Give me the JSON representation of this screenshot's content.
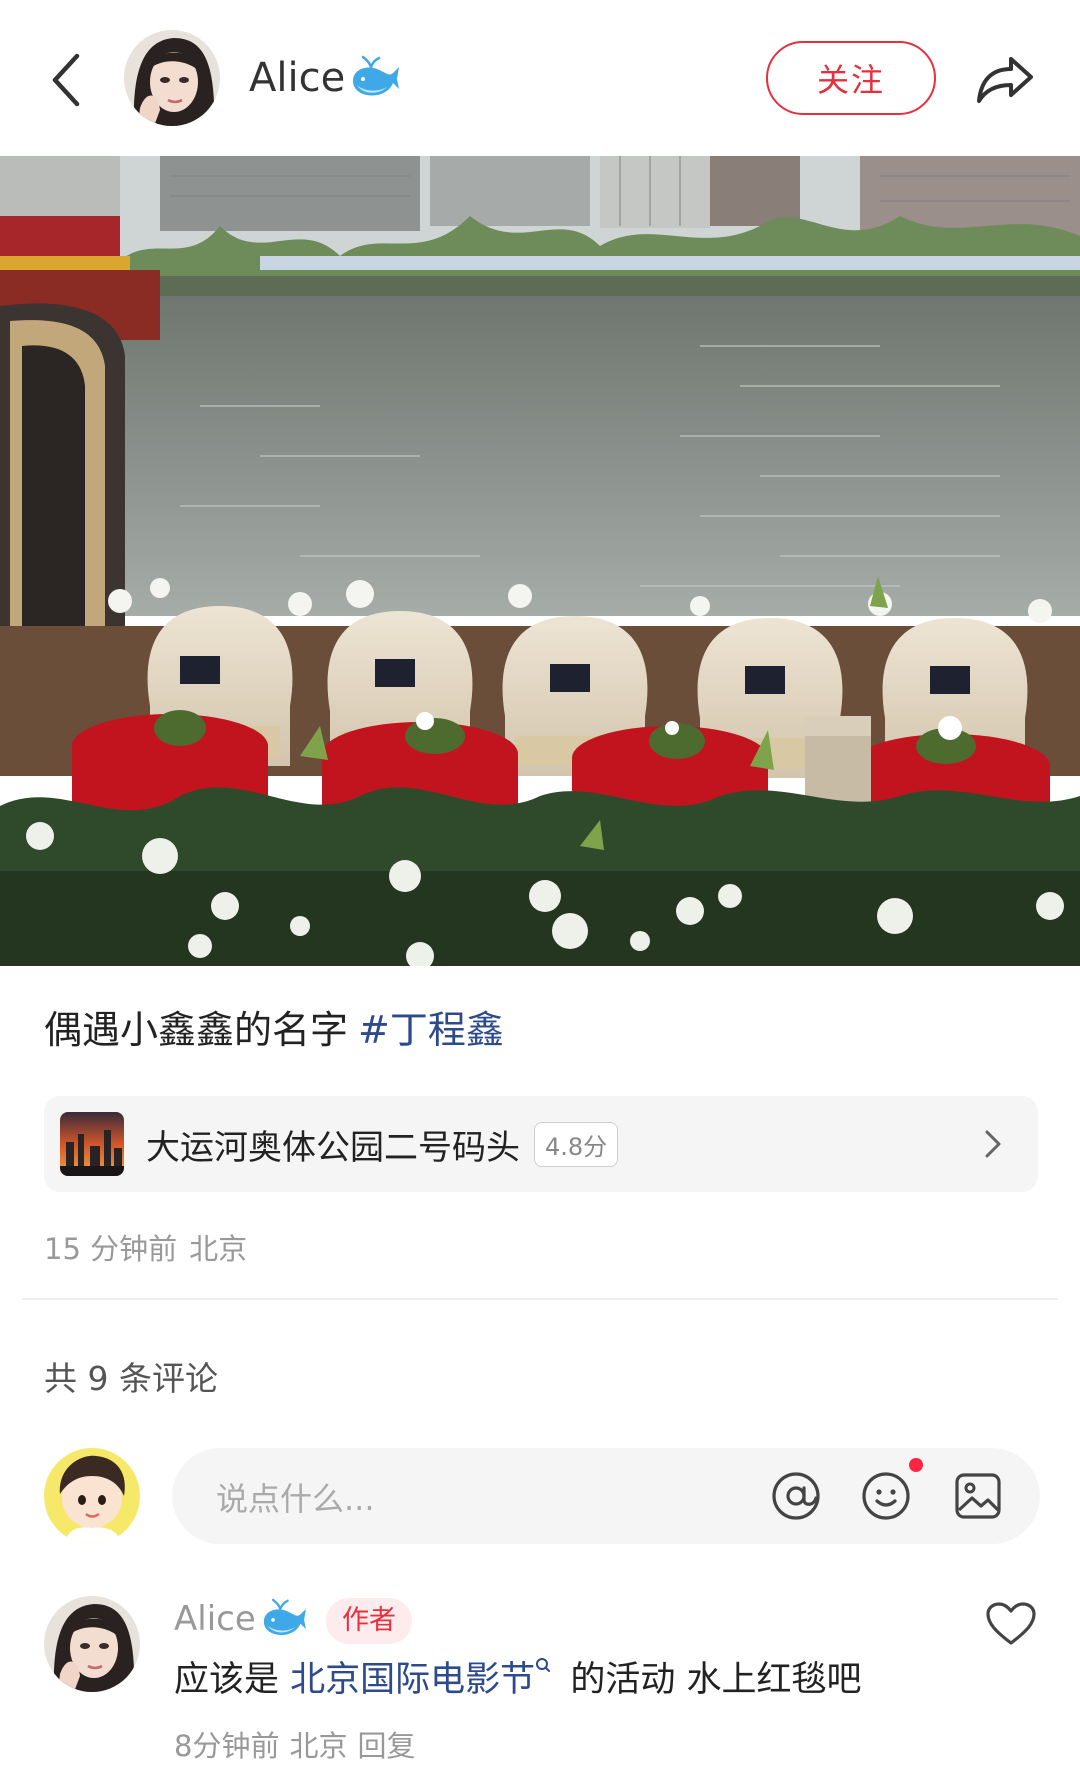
{
  "header": {
    "author_name": "Alice",
    "follow_label": "关注"
  },
  "post": {
    "text": "偶遇小鑫鑫的名字",
    "hashtag": "#丁程鑫",
    "location": {
      "name": "大运河奥体公园二号码头",
      "rating": "4.8分"
    },
    "time": "15 分钟前",
    "region": "北京"
  },
  "comments_section": {
    "count_label": "共 9 条评论",
    "input_placeholder": "说点什么..."
  },
  "comment": {
    "author": "Alice",
    "author_tag": "作者",
    "text_prefix": "应该是",
    "link_text": "北京国际电影节",
    "text_suffix": "的活动 水上红毯吧",
    "time": "8分钟前",
    "region": "北京",
    "reply_label": "回复"
  },
  "colors": {
    "accent": "#e5303e",
    "link": "#2c4a8c",
    "muted": "#999999",
    "input_bg": "#f5f5f5",
    "notify_dot": "#ff2442"
  },
  "icons": [
    "back-arrow-icon",
    "whale-icon",
    "share-icon",
    "chevron-right-icon",
    "at-icon",
    "emoji-icon",
    "image-icon",
    "heart-icon",
    "search-link-icon"
  ]
}
